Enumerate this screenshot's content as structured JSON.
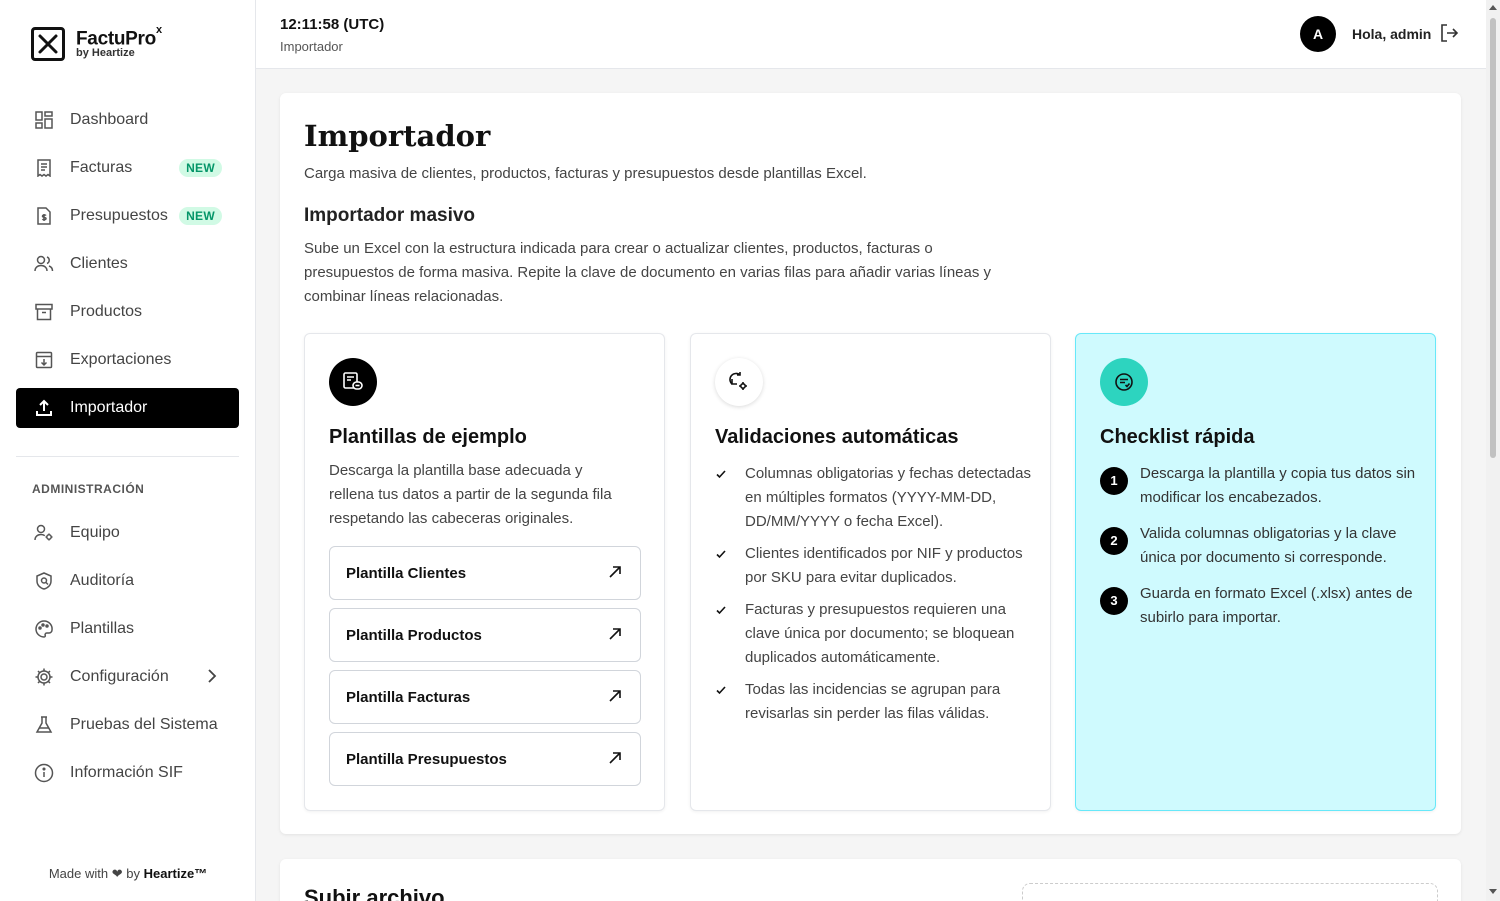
{
  "brand": {
    "name": "FactuPro",
    "sup": "x",
    "sub": "by Heartize"
  },
  "nav": {
    "items": [
      {
        "label": "Dashboard",
        "icon": "dashboard-icon"
      },
      {
        "label": "Facturas",
        "icon": "invoice-icon",
        "badge": "NEW"
      },
      {
        "label": "Presupuestos",
        "icon": "quote-icon",
        "badge": "NEW"
      },
      {
        "label": "Clientes",
        "icon": "users-icon"
      },
      {
        "label": "Productos",
        "icon": "box-icon"
      },
      {
        "label": "Exportaciones",
        "icon": "export-icon"
      },
      {
        "label": "Importador",
        "icon": "upload-icon",
        "active": true
      }
    ],
    "section_label": "ADMINISTRACIÓN",
    "admin_items": [
      {
        "label": "Equipo",
        "icon": "team-icon"
      },
      {
        "label": "Auditoría",
        "icon": "shield-icon"
      },
      {
        "label": "Plantillas",
        "icon": "palette-icon"
      },
      {
        "label": "Configuración",
        "icon": "gear-icon"
      },
      {
        "label": "Pruebas del Sistema",
        "icon": "flask-icon"
      },
      {
        "label": "Información SIF",
        "icon": "info-icon"
      }
    ]
  },
  "footer": {
    "made_with": "Made with",
    "by": "by",
    "brand": "Heartize™"
  },
  "header": {
    "time": "12:11:58 (UTC)",
    "breadcrumb": "Importador",
    "avatar_initial": "A",
    "greeting": "Hola, admin"
  },
  "main": {
    "title": "Importador",
    "subtitle": "Carga masiva de clientes, productos, facturas y presupuestos desde plantillas Excel.",
    "section_title": "Importador masivo",
    "description": "Sube un Excel con la estructura indicada para crear o actualizar clientes, productos, facturas o presupuestos de forma masiva. Repite la clave de documento en varias filas para añadir varias líneas y combinar líneas relacionadas.",
    "templates_card": {
      "title": "Plantillas de ejemplo",
      "text": "Descarga la plantilla base adecuada y rellena tus datos a partir de la segunda fila respetando las cabeceras originales.",
      "buttons": [
        "Plantilla Clientes",
        "Plantilla Productos",
        "Plantilla Facturas",
        "Plantilla Presupuestos"
      ]
    },
    "validations_card": {
      "title": "Validaciones automáticas",
      "items": [
        "Columnas obligatorias y fechas detectadas en múltiples formatos (YYYY-MM-DD, DD/MM/YYYY o fecha Excel).",
        "Clientes identificados por NIF y productos por SKU para evitar duplicados.",
        "Facturas y presupuestos requieren una clave única por documento; se bloquean duplicados automáticamente.",
        "Todas las incidencias se agrupan para revisarlas sin perder las filas válidas."
      ]
    },
    "checklist_card": {
      "title": "Checklist rápida",
      "steps": [
        {
          "num": "1",
          "text": "Descarga la plantilla y copia tus datos sin modificar los encabezados."
        },
        {
          "num": "2",
          "text": "Valida columnas obligatorias y la clave única por documento si corresponde."
        },
        {
          "num": "3",
          "text": "Guarda en formato Excel (.xlsx) antes de subirlo para importar."
        }
      ]
    },
    "upload_title": "Subir archivo"
  },
  "colors": {
    "accent": "#000000",
    "badge_bg": "#d1fae5",
    "badge_text": "#059669",
    "checklist_bg": "#cffafe",
    "checklist_icon": "#2dd4bf"
  }
}
